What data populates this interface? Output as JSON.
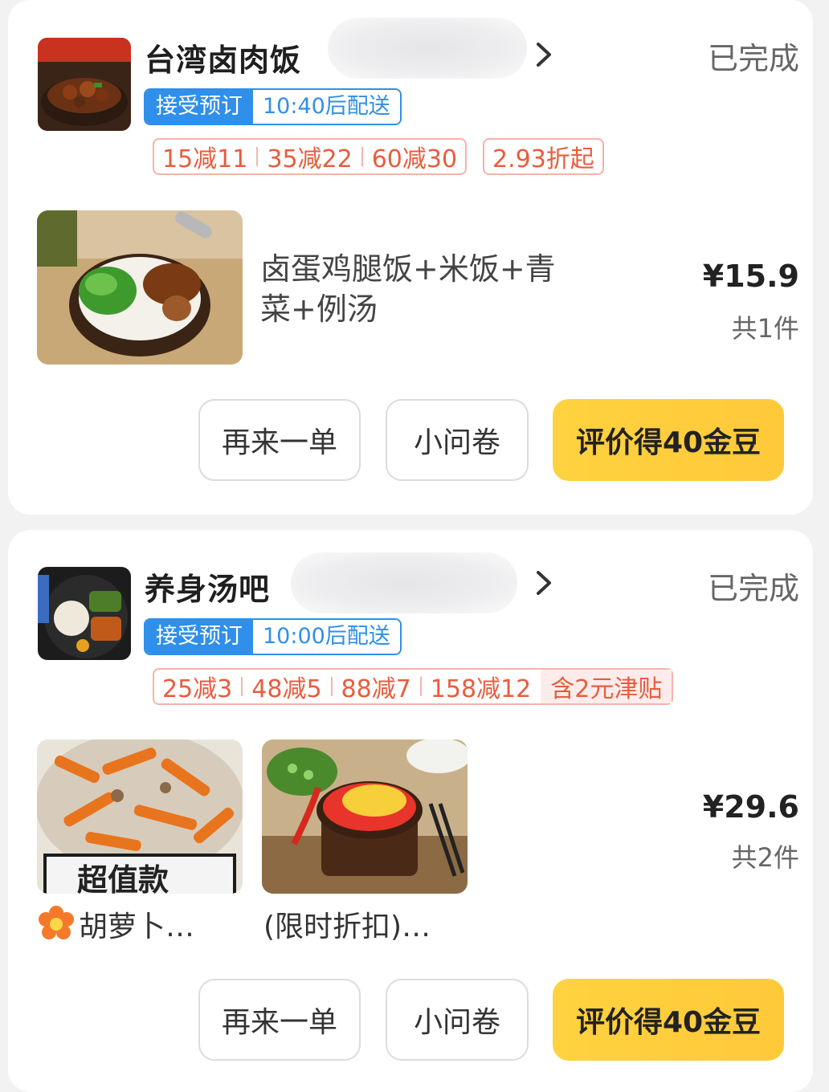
{
  "orders": [
    {
      "shop_name": "台湾卤肉饭",
      "status": "已完成",
      "reserve": {
        "tag": "接受预订",
        "time": "10:40后配送"
      },
      "promos": [
        "15减11",
        "35减22",
        "60减30"
      ],
      "discount": "2.93折起",
      "item_name": "卤蛋鸡腿饭+米饭+青菜+例汤",
      "price": "¥15.9",
      "count": "共1件",
      "buttons": {
        "reorder": "再来一单",
        "survey": "小问卷",
        "review": "评价得40金豆"
      },
      "logo_text": "台湾卤肉饭"
    },
    {
      "shop_name": "养身汤吧",
      "status": "已完成",
      "reserve": {
        "tag": "接受预订",
        "time": "10:00后配送"
      },
      "promos": [
        "25减3",
        "48减5",
        "88减7",
        "158减12"
      ],
      "subsidy": "含2元津贴",
      "items": [
        {
          "caption": "胡萝卜…",
          "badge": "超值款"
        },
        {
          "caption": "(限时折扣)…"
        }
      ],
      "price": "¥29.6",
      "count": "共2件",
      "buttons": {
        "reorder": "再来一单",
        "survey": "小问卷",
        "review": "评价得40金豆"
      }
    }
  ],
  "colors": {
    "blue": "#2f8fea",
    "promo_red": "#e85c3e",
    "yellow": "#ffcc3a"
  },
  "icons": {
    "chevron": "chevron-right-icon",
    "flower": "flower-icon"
  }
}
